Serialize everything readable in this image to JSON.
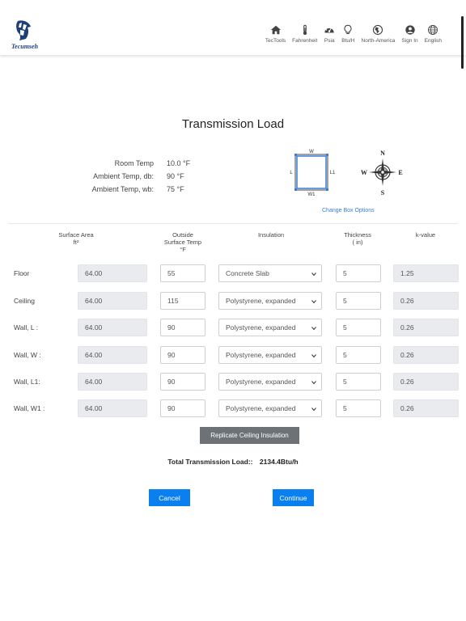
{
  "brand": {
    "name": "Tecumseh"
  },
  "nav": [
    {
      "label": "TecTools",
      "icon": "home-icon"
    },
    {
      "label": "Fahrenheit",
      "icon": "thermometer-icon"
    },
    {
      "label": "Psia",
      "icon": "gauge-icon"
    },
    {
      "label": "Btu/H",
      "icon": "lightbulb-icon"
    },
    {
      "label": "North-America",
      "icon": "globe-region-icon"
    },
    {
      "label": "Sign In",
      "icon": "user-icon"
    },
    {
      "label": "English",
      "icon": "language-globe-icon"
    }
  ],
  "page": {
    "title": "Transmission Load"
  },
  "temps": [
    {
      "label": "Room Temp",
      "value": "10.0 °F"
    },
    {
      "label": "Ambient Temp, db:",
      "value": "90 °F"
    },
    {
      "label": "Ambient Temp, wb:",
      "value": "75 °F"
    }
  ],
  "box": {
    "top": "W",
    "bottom": "W1",
    "left": "L",
    "right": "L1",
    "link": "Change Box Options"
  },
  "compass": {
    "n": "N",
    "s": "S",
    "e": "E",
    "w": "W"
  },
  "table": {
    "headers": {
      "surface_area": "Surface Area",
      "surface_area_unit": "ft²",
      "outside_temp_1": "Outside",
      "outside_temp_2": "Surface Temp",
      "outside_temp_unit": "°F",
      "insulation": "Insulation",
      "thickness": "Thickness",
      "thickness_unit": "( in)",
      "kvalue": "k-value"
    },
    "rows": [
      {
        "label": "Floor",
        "area": "64.00",
        "temp": "55",
        "insulation": "Concrete Slab",
        "thickness": "5",
        "k": "1.25"
      },
      {
        "label": "Ceiling",
        "area": "64.00",
        "temp": "115",
        "insulation": "Polystyrene, expanded",
        "thickness": "5",
        "k": "0.26"
      },
      {
        "label": "Wall, L :",
        "area": "64.00",
        "temp": "90",
        "insulation": "Polystyrene, expanded",
        "thickness": "5",
        "k": "0.26"
      },
      {
        "label": "Wall, W :",
        "area": "64.00",
        "temp": "90",
        "insulation": "Polystyrene, expanded",
        "thickness": "5",
        "k": "0.26"
      },
      {
        "label": "Wall, L1:",
        "area": "64.00",
        "temp": "90",
        "insulation": "Polystyrene, expanded",
        "thickness": "5",
        "k": "0.26"
      },
      {
        "label": "Wall, W1 :",
        "area": "64.00",
        "temp": "90",
        "insulation": "Polystyrene, expanded",
        "thickness": "5",
        "k": "0.26"
      }
    ]
  },
  "actions": {
    "replicate": "Replicate Ceiling Insulation",
    "total_label": "Total Transmission Load::",
    "total_value": "2134.4Btu/h",
    "cancel": "Cancel",
    "continue": "Continue"
  },
  "colors": {
    "primary": "#0a7ff0",
    "secondary": "#6d7277",
    "link": "#3b7bd5",
    "readonly": "#e9ebee"
  }
}
